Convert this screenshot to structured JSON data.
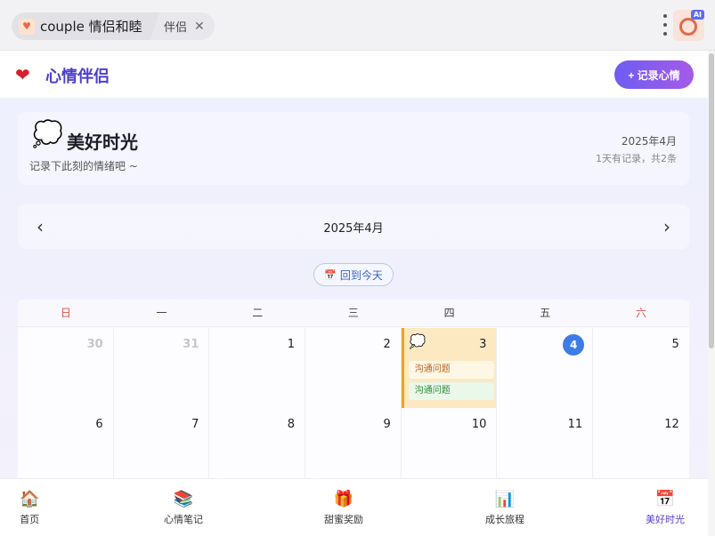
{
  "browser": {
    "active_tab_title": "couple 情侣和睦",
    "inactive_tab_title": "伴侣",
    "ai_badge": "AI"
  },
  "header": {
    "brand": "心情伴侣",
    "record_button": "+ 记录心情"
  },
  "hero": {
    "title": "美好时光",
    "subtitle": "记录下此刻的情绪吧 ~",
    "month": "2025年4月",
    "count": "1天有记录，共2条"
  },
  "calendar": {
    "nav_month": "2025年4月",
    "today_button": "回到今天",
    "weekdays": [
      "日",
      "一",
      "二",
      "三",
      "四",
      "五",
      "六"
    ],
    "rows": [
      [
        "30",
        "31",
        "1",
        "2",
        "3",
        "4",
        "5"
      ],
      [
        "6",
        "7",
        "8",
        "9",
        "10",
        "11",
        "12"
      ]
    ],
    "entries": [
      "沟通问题",
      "沟通问题"
    ]
  },
  "bottom_nav": [
    {
      "label": "首页",
      "icon": "house-icon"
    },
    {
      "label": "心情笔记",
      "icon": "books-icon"
    },
    {
      "label": "甜蜜奖励",
      "icon": "gift-icon"
    },
    {
      "label": "成长旅程",
      "icon": "chart-icon"
    },
    {
      "label": "美好时光",
      "icon": "calendar-icon"
    }
  ],
  "colors": {
    "accent": "#4b3fc9",
    "today": "#3d7be8",
    "selected_day": "#fce9c2"
  }
}
